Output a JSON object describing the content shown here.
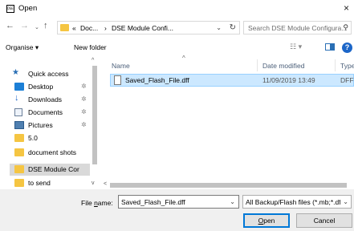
{
  "window": {
    "icon_text": "DSE",
    "title": "Open",
    "close_glyph": "×"
  },
  "nav": {
    "back_glyph": "←",
    "forward_glyph": "→",
    "recent_glyph": "⌄",
    "up_glyph": "↑"
  },
  "address": {
    "overflow": "«",
    "crumb1": "Doc...",
    "sep1": "›",
    "crumb2": "DSE Module Confi...",
    "chevron": "⌄",
    "refresh_glyph": "↻"
  },
  "search": {
    "placeholder": "Search DSE Module Configura...",
    "icon": "search-icon"
  },
  "toolbar": {
    "organise_label": "Organise ▾",
    "new_folder_label": "New folder",
    "view_glyph": "☷ ▾",
    "help_glyph": "?"
  },
  "sidebar": {
    "items": [
      {
        "label": "Quick access",
        "icon": "star-icon",
        "pin": ""
      },
      {
        "label": "Desktop",
        "icon": "desktop-icon",
        "pin": "✲"
      },
      {
        "label": "Downloads",
        "icon": "downloads-icon",
        "pin": "✲"
      },
      {
        "label": "Documents",
        "icon": "documents-icon",
        "pin": "✲"
      },
      {
        "label": "Pictures",
        "icon": "pictures-icon",
        "pin": "✲"
      },
      {
        "label": "5.0",
        "icon": "folder-icon",
        "pin": ""
      },
      {
        "label": "document shots",
        "icon": "folder-icon",
        "pin": ""
      },
      {
        "label": "DSE Module Cor",
        "icon": "folder-icon",
        "pin": ""
      },
      {
        "label": "to send",
        "icon": "folder-icon",
        "pin": ""
      }
    ],
    "scroll_up": "^",
    "scroll_down": "v"
  },
  "columns": {
    "name": "Name",
    "date": "Date modified",
    "type": "Type",
    "sort_glyph": "^"
  },
  "files": [
    {
      "name": "Saved_Flash_File.dff",
      "date": "11/09/2019 13:49",
      "type": "DFF File"
    }
  ],
  "hscroll": {
    "left_glyph": "<"
  },
  "footer": {
    "file_name_label_pre": "File ",
    "file_name_label_u": "n",
    "file_name_label_post": "ame:",
    "file_name_value": "Saved_Flash_File.dff",
    "file_name_chevron": "⌄",
    "filter_value": "All Backup/Flash files (*.mb;*.dff)",
    "filter_chevron": "⌄",
    "open_label_u": "O",
    "open_label_rest": "pen",
    "cancel_label": "Cancel"
  },
  "colors": {
    "selection_bg": "#cce8ff",
    "selection_border": "#99d1ff",
    "folder": "#f5c542",
    "accent": "#0078d7"
  }
}
